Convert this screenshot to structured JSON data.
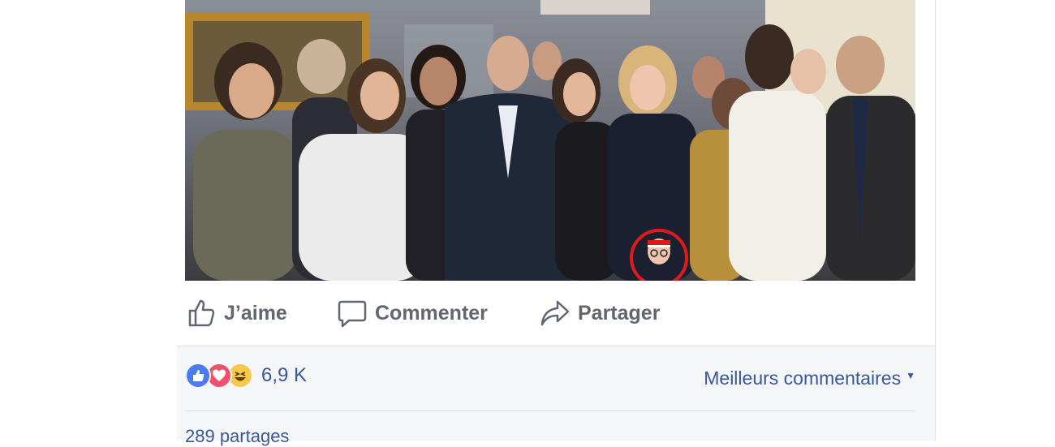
{
  "post": {
    "photo_alt": "Photo de groupe",
    "actions": {
      "like_label": "J’aime",
      "comment_label": "Commenter",
      "share_label": "Partager"
    },
    "reactions": {
      "icons": [
        "like-icon",
        "love-icon",
        "haha-icon"
      ],
      "count": "6,9 K",
      "colors": {
        "like": "#4a7bf0",
        "love": "#f0506e",
        "haha": "#f7c94b"
      }
    },
    "sort_label": "Meilleurs commentaires",
    "shares_label": "289 partages"
  },
  "colors": {
    "link": "#385898",
    "action_text": "#606770",
    "annotation": "#e0191b"
  }
}
